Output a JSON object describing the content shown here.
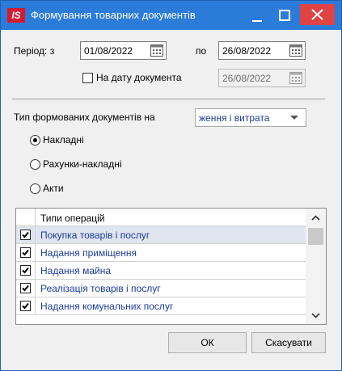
{
  "window": {
    "title": "Формування товарних документів",
    "logo_text": "IS",
    "controls": [
      "minimize-icon",
      "maximize-icon",
      "close-icon"
    ],
    "accent_color": "#2b7bd9",
    "close_color": "#e04343"
  },
  "period": {
    "label": "Період: з",
    "from_value": "01/08/2022",
    "to_label": "по",
    "to_value": "26/08/2022"
  },
  "doc_date": {
    "checkbox_label": "На дату документа",
    "checked": false,
    "value": "26/08/2022"
  },
  "doc_type": {
    "label": "Тип формованих документів на",
    "select_value": "ження і витрата"
  },
  "radios": [
    {
      "label": "Накладні",
      "selected": true
    },
    {
      "label": "Рахунки-накладні",
      "selected": false
    },
    {
      "label": "Акти",
      "selected": false
    }
  ],
  "operations": {
    "header": "Типи операцій",
    "rows": [
      {
        "label": "Покупка товарів і послуг",
        "checked": true,
        "selected": true
      },
      {
        "label": "Надання приміщення",
        "checked": true,
        "selected": false
      },
      {
        "label": "Надання майна",
        "checked": true,
        "selected": false
      },
      {
        "label": "Реалізація товарів і послуг",
        "checked": true,
        "selected": false
      },
      {
        "label": "Надання комунальних послуг",
        "checked": true,
        "selected": false
      }
    ]
  },
  "buttons": {
    "ok": "ОК",
    "cancel": "Скасувати"
  }
}
